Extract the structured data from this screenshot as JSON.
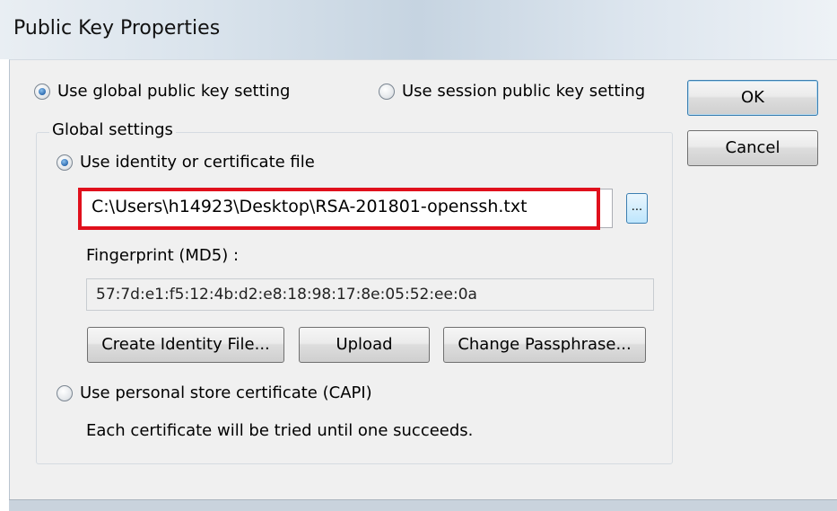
{
  "window": {
    "title": "Public Key Properties"
  },
  "scope": {
    "global_label": "Use global public key setting",
    "global_selected": true,
    "session_label": "Use session public key setting",
    "session_selected": false
  },
  "buttons": {
    "ok": "OK",
    "cancel": "Cancel"
  },
  "global_settings": {
    "title": "Global settings",
    "identity_option": {
      "label": "Use identity or certificate file",
      "selected": true,
      "file_path": "C:\\Users\\h14923\\Desktop\\RSA-201801-openssh.txt",
      "browse_label": "..."
    },
    "fingerprint": {
      "label": "Fingerprint (MD5) :",
      "value": "57:7d:e1:f5:12:4b:d2:e8:18:98:17:8e:05:52:ee:0a"
    },
    "actions": {
      "create": "Create Identity File...",
      "upload": "Upload",
      "change_passphrase": "Change Passphrase..."
    },
    "capi_option": {
      "label": "Use personal store certificate (CAPI)",
      "selected": false,
      "note": "Each certificate will be tried until one succeeds."
    }
  },
  "colors": {
    "highlight": "#e0101c",
    "accent": "#2d6bb0"
  }
}
